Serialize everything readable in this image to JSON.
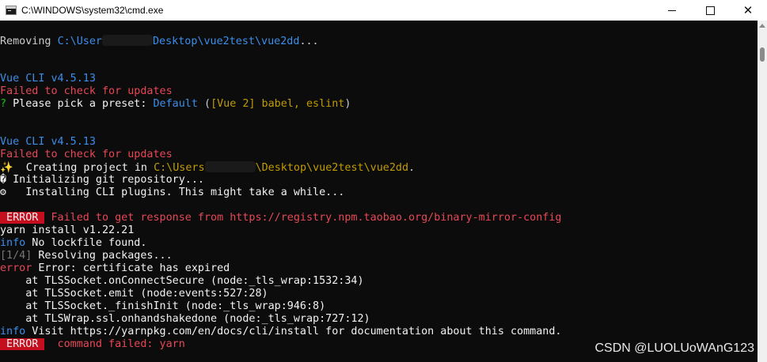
{
  "window": {
    "title": "C:\\WINDOWS\\system32\\cmd.exe",
    "icon": "cmd-app-icon",
    "controls": {
      "minimize_icon": "minimize-icon",
      "maximize_icon": "maximize-icon",
      "close_icon": "close-icon",
      "close_glyph": "✕"
    }
  },
  "colors": {
    "background": "#0c0c0c",
    "blue": "#3b8eea",
    "red": "#e74856",
    "yellow": "#c19c00",
    "green": "#16c60c",
    "error_badge": "#c50f1f"
  },
  "console": {
    "lines": [
      {
        "parts": [
          "Removing ",
          "C:\\User",
          "Desktop\\vue2test\\vue2dd",
          "..."
        ]
      },
      {
        "parts": [
          "Vue CLI v4.5.13"
        ]
      },
      {
        "parts": [
          "Failed to check for updates"
        ]
      },
      {
        "parts": [
          "?",
          " Please pick a preset: ",
          "Default",
          " (",
          "[Vue 2] babel, eslint",
          ")"
        ]
      },
      {
        "parts": [
          "Vue CLI v4.5.13"
        ]
      },
      {
        "parts": [
          "Failed to check for updates"
        ]
      },
      {
        "parts": [
          "✨",
          "  Creating project in ",
          "C:\\Users",
          "\\Desktop\\vue2test\\vue2dd",
          "."
        ]
      },
      {
        "parts": [
          "�",
          " Initializing git repository..."
        ]
      },
      {
        "parts": [
          "⚙",
          "   Installing CLI plugins. This might take a while..."
        ]
      },
      {
        "parts": [
          " ERROR ",
          " Failed to get response from https://registry.npm.taobao.org/binary-mirror-config"
        ]
      },
      {
        "parts": [
          "yarn install v1.22.21"
        ]
      },
      {
        "parts": [
          "info",
          " No lockfile found."
        ]
      },
      {
        "parts": [
          "[1/4]",
          " Resolving packages..."
        ]
      },
      {
        "parts": [
          "error",
          " Error: certificate has expired"
        ]
      },
      {
        "parts": [
          "    at TLSSocket.onConnectSecure (node:_tls_wrap:1532:34)"
        ]
      },
      {
        "parts": [
          "    at TLSSocket.emit (node:events:527:28)"
        ]
      },
      {
        "parts": [
          "    at TLSSocket._finishInit (node:_tls_wrap:946:8)"
        ]
      },
      {
        "parts": [
          "    at TLSWrap.ssl.onhandshakedone (node:_tls_wrap:727:12)"
        ]
      },
      {
        "parts": [
          "info",
          " Visit https://yarnpkg.com/en/docs/cli/install for documentation about this command."
        ]
      },
      {
        "parts": [
          " ERROR ",
          "  command failed: yarn"
        ]
      }
    ]
  },
  "watermark": "CSDN @LUOLUoWAnG123"
}
